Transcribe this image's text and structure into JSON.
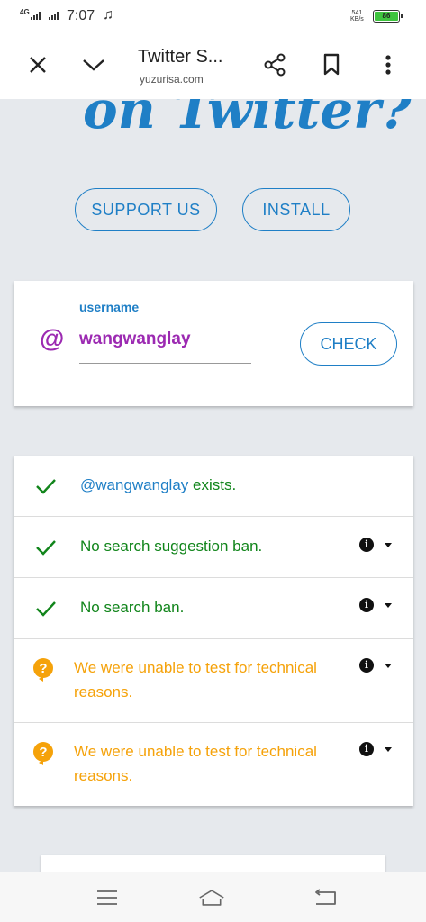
{
  "status_bar": {
    "network": "4G",
    "time": "7:07",
    "speed_value": "541",
    "speed_unit": "KB/s",
    "battery": "86",
    "icons": [
      "signal-icon",
      "music-note-icon",
      "battery-icon"
    ]
  },
  "browser": {
    "title": "Twitter S...",
    "url": "yuzurisa.com",
    "icons": [
      "close-icon",
      "chevron-down-icon",
      "share-icon",
      "bookmark-icon",
      "more-vertical-icon"
    ]
  },
  "hero": {
    "title_fragment": "on Twitter?"
  },
  "actions": {
    "support_label": "SUPPORT US",
    "install_label": "INSTALL"
  },
  "form": {
    "at_symbol": "@",
    "label": "username",
    "value": "wangwanglay",
    "check_label": "CHECK"
  },
  "results": [
    {
      "status": "ok",
      "handle": "@wangwanglay",
      "text": " exists.",
      "has_info": false
    },
    {
      "status": "ok",
      "text": "No search suggestion ban.",
      "has_info": true
    },
    {
      "status": "ok",
      "text": "No search ban.",
      "has_info": true
    },
    {
      "status": "unknown",
      "line1": "We were unable to test for technical",
      "line2": "reasons.",
      "has_info": true
    },
    {
      "status": "unknown",
      "line1": "We were unable to test for technical",
      "line2": "reasons.",
      "has_info": true
    }
  ],
  "colors": {
    "accent_blue": "#1f7fc6",
    "purple": "#9c2ab2",
    "success_green": "#11851b",
    "warning_orange": "#f5a20a",
    "page_bg": "#e6e9ed"
  },
  "navbar": {
    "icons": [
      "menu-icon",
      "home-icon",
      "back-icon"
    ]
  }
}
